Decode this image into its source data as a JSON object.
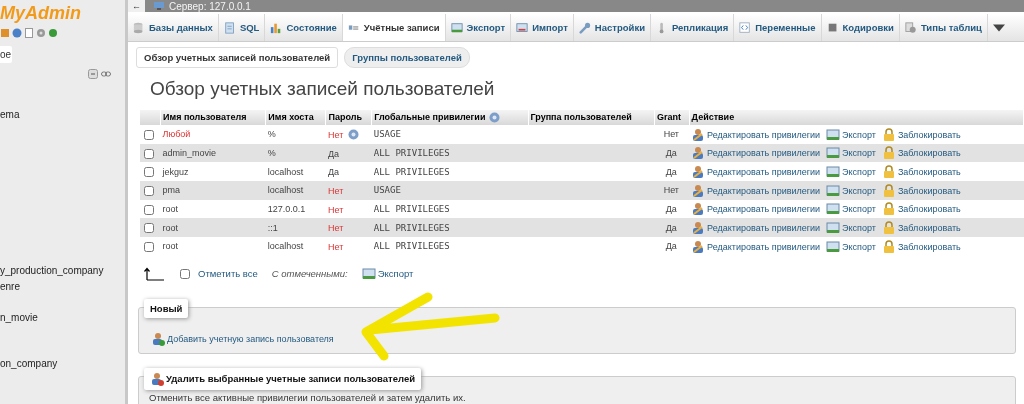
{
  "sidebar": {
    "logo": "MyAdmin",
    "recent": "oe",
    "items": [
      {
        "label": "ema"
      },
      {
        "label": "y_production_company"
      },
      {
        "label": "enre"
      },
      {
        "label": "n_movie"
      },
      {
        "label": "on_company"
      }
    ]
  },
  "topbar": {
    "back": "←",
    "server": "Сервер: 127.0.0.1"
  },
  "tabs": [
    {
      "label": "Базы данных",
      "selected": false
    },
    {
      "label": "SQL",
      "selected": false
    },
    {
      "label": "Состояние",
      "selected": false
    },
    {
      "label": "Учётные записи",
      "selected": true
    },
    {
      "label": "Экспорт",
      "selected": false
    },
    {
      "label": "Импорт",
      "selected": false
    },
    {
      "label": "Настройки",
      "selected": false
    },
    {
      "label": "Репликация",
      "selected": false
    },
    {
      "label": "Переменные",
      "selected": false
    },
    {
      "label": "Кодировки",
      "selected": false
    },
    {
      "label": "Типы таблиц",
      "selected": false
    }
  ],
  "subtabs": [
    {
      "label": "Обзор учетных записей пользователей",
      "selected": true
    },
    {
      "label": "Группы пользователей",
      "selected": false
    }
  ],
  "heading": "Обзор учетных записей пользователей",
  "table": {
    "columns": [
      "Имя пользователя",
      "Имя хоста",
      "Пароль",
      "Глобальные привилегии",
      "Группа пользователей",
      "Grant",
      "Действие"
    ],
    "rows": [
      {
        "checked": false,
        "user": "Любой",
        "any_user": true,
        "host": "%",
        "password": "Нет",
        "has_password": false,
        "password_help": true,
        "privileges": "USAGE",
        "grant": "Нет",
        "edit": "Редактировать привилегии",
        "export": "Экспорт",
        "lock": "Заблокировать"
      },
      {
        "checked": false,
        "user": "admin_movie",
        "any_user": false,
        "host": "%",
        "password": "Да",
        "has_password": true,
        "password_help": false,
        "privileges": "ALL PRIVILEGES",
        "grant": "Да",
        "edit": "Редактировать привилегии",
        "export": "Экспорт",
        "lock": "Заблокировать"
      },
      {
        "checked": false,
        "user": "jekguz",
        "any_user": false,
        "host": "localhost",
        "password": "Да",
        "has_password": true,
        "password_help": false,
        "privileges": "ALL PRIVILEGES",
        "grant": "Да",
        "edit": "Редактировать привилегии",
        "export": "Экспорт",
        "lock": "Заблокировать"
      },
      {
        "checked": false,
        "user": "pma",
        "any_user": false,
        "host": "localhost",
        "password": "Нет",
        "has_password": false,
        "password_help": false,
        "privileges": "USAGE",
        "grant": "Нет",
        "edit": "Редактировать привилегии",
        "export": "Экспорт",
        "lock": "Заблокировать"
      },
      {
        "checked": false,
        "user": "root",
        "any_user": false,
        "host": "127.0.0.1",
        "password": "Нет",
        "has_password": false,
        "password_help": false,
        "privileges": "ALL PRIVILEGES",
        "grant": "Да",
        "edit": "Редактировать привилегии",
        "export": "Экспорт",
        "lock": "Заблокировать"
      },
      {
        "checked": false,
        "user": "root",
        "any_user": false,
        "host": "::1",
        "password": "Нет",
        "has_password": false,
        "password_help": false,
        "privileges": "ALL PRIVILEGES",
        "grant": "Да",
        "edit": "Редактировать привилегии",
        "export": "Экспорт",
        "lock": "Заблокировать"
      },
      {
        "checked": false,
        "user": "root",
        "any_user": false,
        "host": "localhost",
        "password": "Нет",
        "has_password": false,
        "password_help": false,
        "privileges": "ALL PRIVILEGES",
        "grant": "Да",
        "edit": "Редактировать привилегии",
        "export": "Экспорт",
        "lock": "Заблокировать"
      }
    ]
  },
  "footer": {
    "check_all": "Отметить все",
    "check_all_checked": false,
    "with_selected": "С отмеченными:",
    "export": "Экспорт"
  },
  "new_section": {
    "legend": "Новый",
    "link": "Добавить учетную запись пользователя"
  },
  "delete_section": {
    "legend": "Удалить выбранные учетные записи пользователей",
    "text": "Отменить все активные привилегии пользователей и затем удалить их."
  },
  "overlay": {
    "kind": "arrow"
  }
}
